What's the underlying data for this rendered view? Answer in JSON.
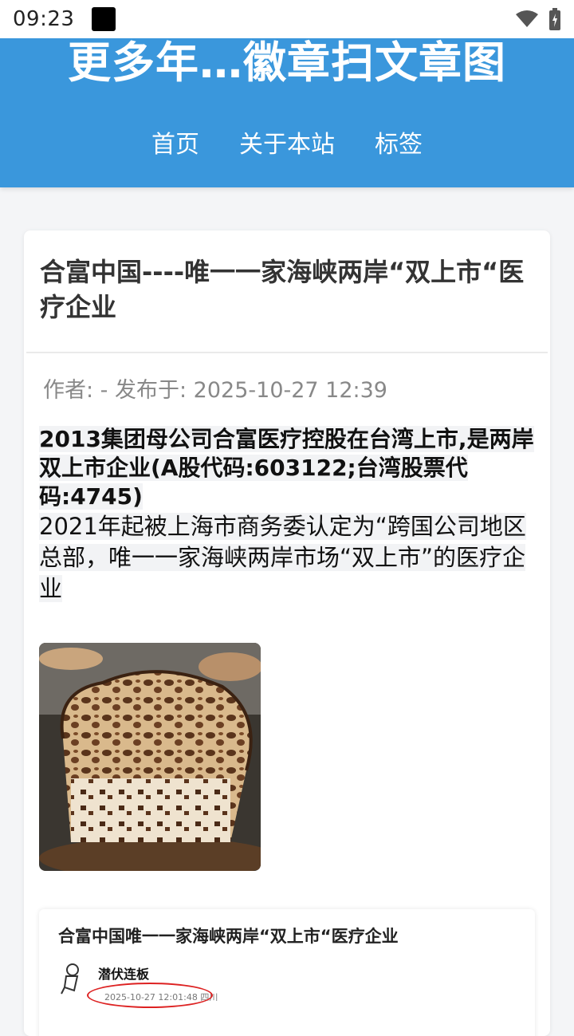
{
  "status": {
    "time": "09:23"
  },
  "header": {
    "title": "更多年…徽章扫文章图",
    "nav": [
      "首页",
      "关于本站",
      "标签"
    ]
  },
  "post": {
    "title": "合富中国----唯一一家海峡两岸“双上市“医疗企业",
    "meta": "作者: - 发布于: 2025-10-27 12:39",
    "bold_paragraph": "2013集团母公司合富医疗控股在台湾上市,是两岸双上市企业(A股代码:603122;台湾股票代码:4745)",
    "paragraph": "2021年起被上海市商务委认定为“跨国公司地区总部，唯一一家海峡两岸市场“双上市”的医疗企业"
  },
  "embed": {
    "title": "合富中国唯一一家海峡两岸“双上市“医疗企业",
    "author": "潜伏连板",
    "date": "2025-10-27 12:01:48 四川"
  },
  "icons": {
    "wifi": "wifi-icon",
    "battery": "battery-charging-icon",
    "notification": "app-notification-icon",
    "avatar": "astronaut-avatar-icon"
  },
  "colors": {
    "header_bg": "#3a97dc",
    "page_bg": "#f4f5f7",
    "highlight": "#f2f3f5",
    "annotation_ring": "#dd2222"
  }
}
